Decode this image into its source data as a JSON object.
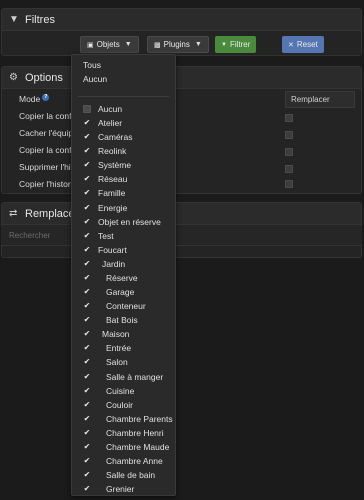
{
  "filters_panel": {
    "title": "Filtres",
    "buttons": {
      "objets": "Objets",
      "plugins": "Plugins",
      "filtrer": "Filtrer",
      "reset": "Reset"
    }
  },
  "options_panel": {
    "title": "Options",
    "rows": [
      "Mode",
      "Copier la configuration",
      "Cacher l'équipement",
      "Copier la configuration commande",
      "Supprimer l'historique",
      "Copier l'historique"
    ],
    "replace_label": "Remplacer"
  },
  "replacement_panel": {
    "title": "Remplacement",
    "search_placeholder": "Rechercher"
  },
  "dropdown": {
    "tous": "Tous",
    "aucun": "Aucun",
    "items": [
      {
        "label": "Aucun",
        "checked": false,
        "indent": 0
      },
      {
        "label": "Atelier",
        "checked": true,
        "indent": 0
      },
      {
        "label": "Caméras",
        "checked": true,
        "indent": 0
      },
      {
        "label": "Reolink",
        "checked": true,
        "indent": 0
      },
      {
        "label": "Système",
        "checked": true,
        "indent": 0
      },
      {
        "label": "Réseau",
        "checked": true,
        "indent": 0
      },
      {
        "label": "Famille",
        "checked": true,
        "indent": 0
      },
      {
        "label": "Energie",
        "checked": true,
        "indent": 0
      },
      {
        "label": "Objet en réserve",
        "checked": true,
        "indent": 0
      },
      {
        "label": "Test",
        "checked": true,
        "indent": 0
      },
      {
        "label": "Foucart",
        "checked": true,
        "indent": 0
      },
      {
        "label": "Jardin",
        "checked": true,
        "indent": 1
      },
      {
        "label": "Réserve",
        "checked": true,
        "indent": 2
      },
      {
        "label": "Garage",
        "checked": true,
        "indent": 2
      },
      {
        "label": "Conteneur",
        "checked": true,
        "indent": 2
      },
      {
        "label": "Bat Bois",
        "checked": true,
        "indent": 2
      },
      {
        "label": "Maison",
        "checked": true,
        "indent": 1
      },
      {
        "label": "Entrée",
        "checked": true,
        "indent": 2
      },
      {
        "label": "Salon",
        "checked": true,
        "indent": 2
      },
      {
        "label": "Salle à manger",
        "checked": true,
        "indent": 2
      },
      {
        "label": "Cuisine",
        "checked": true,
        "indent": 2
      },
      {
        "label": "Couloir",
        "checked": true,
        "indent": 2
      },
      {
        "label": "Chambre Parents",
        "checked": true,
        "indent": 2
      },
      {
        "label": "Chambre Henri",
        "checked": true,
        "indent": 2
      },
      {
        "label": "Chambre Maude",
        "checked": true,
        "indent": 2
      },
      {
        "label": "Chambre Anne",
        "checked": true,
        "indent": 2
      },
      {
        "label": "Salle de bain",
        "checked": true,
        "indent": 2
      },
      {
        "label": "Grenier",
        "checked": true,
        "indent": 2
      }
    ]
  }
}
